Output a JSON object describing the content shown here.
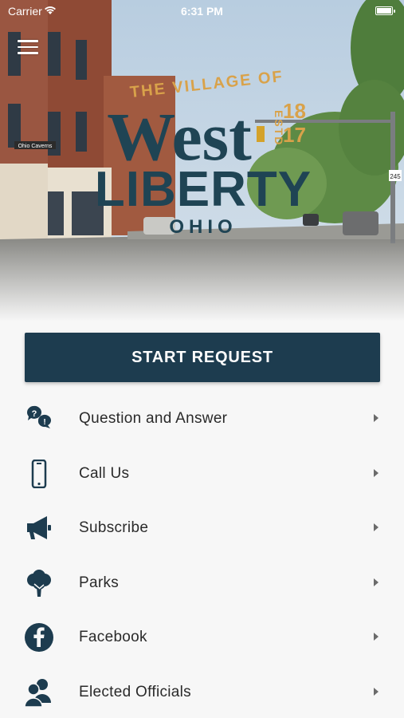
{
  "statusbar": {
    "carrier": "Carrier",
    "time": "6:31 PM"
  },
  "hero": {
    "line1": "THE VILLAGE OF",
    "line2": "West",
    "line3": "LIBERTY",
    "line4": "OHIO",
    "est": "ESTD",
    "year_top": "18",
    "year_bottom": "17",
    "street_sign": "Ohio Caverns",
    "route_sign": "245"
  },
  "primary_action": {
    "label": "START REQUEST"
  },
  "menu": {
    "items": [
      {
        "label": "Question and Answer",
        "icon": "question-answer-icon"
      },
      {
        "label": "Call Us",
        "icon": "phone-icon"
      },
      {
        "label": "Subscribe",
        "icon": "megaphone-icon"
      },
      {
        "label": "Parks",
        "icon": "tree-icon"
      },
      {
        "label": "Facebook",
        "icon": "facebook-icon"
      },
      {
        "label": "Elected Officials",
        "icon": "officials-icon"
      }
    ]
  },
  "colors": {
    "primary": "#1d3c4f",
    "gold": "#d9a24a",
    "text": "#2a2a2a"
  }
}
